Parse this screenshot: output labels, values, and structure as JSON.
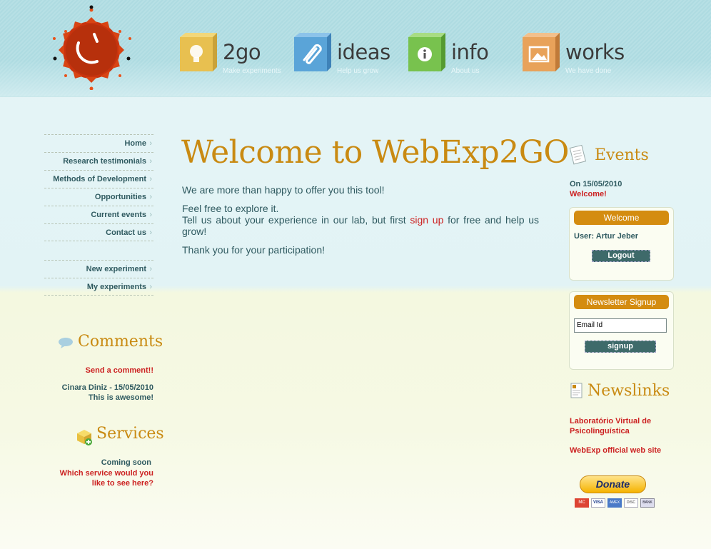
{
  "nav": [
    {
      "title": "2go",
      "subtitle": "Make experiments",
      "color": "#e8c050",
      "icon": "lightbulb-icon"
    },
    {
      "title": "ideas",
      "subtitle": "Help us grow",
      "color": "#5aa4d8",
      "icon": "paperclip-icon"
    },
    {
      "title": "info",
      "subtitle": "About us",
      "color": "#78c24e",
      "icon": "info-icon"
    },
    {
      "title": "works",
      "subtitle": "We have done",
      "color": "#e8a25a",
      "icon": "picture-icon"
    }
  ],
  "left_menu": [
    "Home",
    "Research testimonials",
    "Methods of Development",
    "Opportunities",
    "Current events",
    "Contact us"
  ],
  "left_menu2": [
    "New experiment",
    "My experiments"
  ],
  "comments": {
    "heading": "Comments",
    "send_link": "Send a comment!!",
    "author_line": "Cinara Diniz - 15/05/2010",
    "text": "This is awesome!"
  },
  "services": {
    "heading": "Services",
    "coming": "Coming soon",
    "question_line1": "Which service would you",
    "question_line2": "like to see here?"
  },
  "main": {
    "title": "Welcome to WebExp2GO",
    "p1": "We are more than happy to offer you this tool!",
    "p2_line1": "Feel free to explore it.",
    "p2_before": "Tell us about your experience in our lab, but first ",
    "p2_link": "sign up",
    "p2_after": " for free and help us grow!",
    "p3": "Thank you for your participation!"
  },
  "events": {
    "heading": "Events",
    "date": "On 15/05/2010",
    "item": "Welcome!"
  },
  "welcome_box": {
    "header": "Welcome",
    "user": "User: Artur Jeber",
    "logout": "Logout"
  },
  "newsletter": {
    "header": "Newsletter Signup",
    "placeholder": "Email Id",
    "button": "signup"
  },
  "newslinks": {
    "heading": "Newslinks",
    "link1_line1": "Laboratório Virtual de",
    "link1_line2": "Psicolinguística",
    "link2": "WebExp official web site"
  },
  "donate": {
    "label": "Donate",
    "cards": [
      "MC",
      "VISA",
      "AMEX",
      "DISC",
      "BANK"
    ]
  },
  "colors": {
    "accent": "#c98a12",
    "link": "#cc2222",
    "text": "#2f5a60"
  }
}
